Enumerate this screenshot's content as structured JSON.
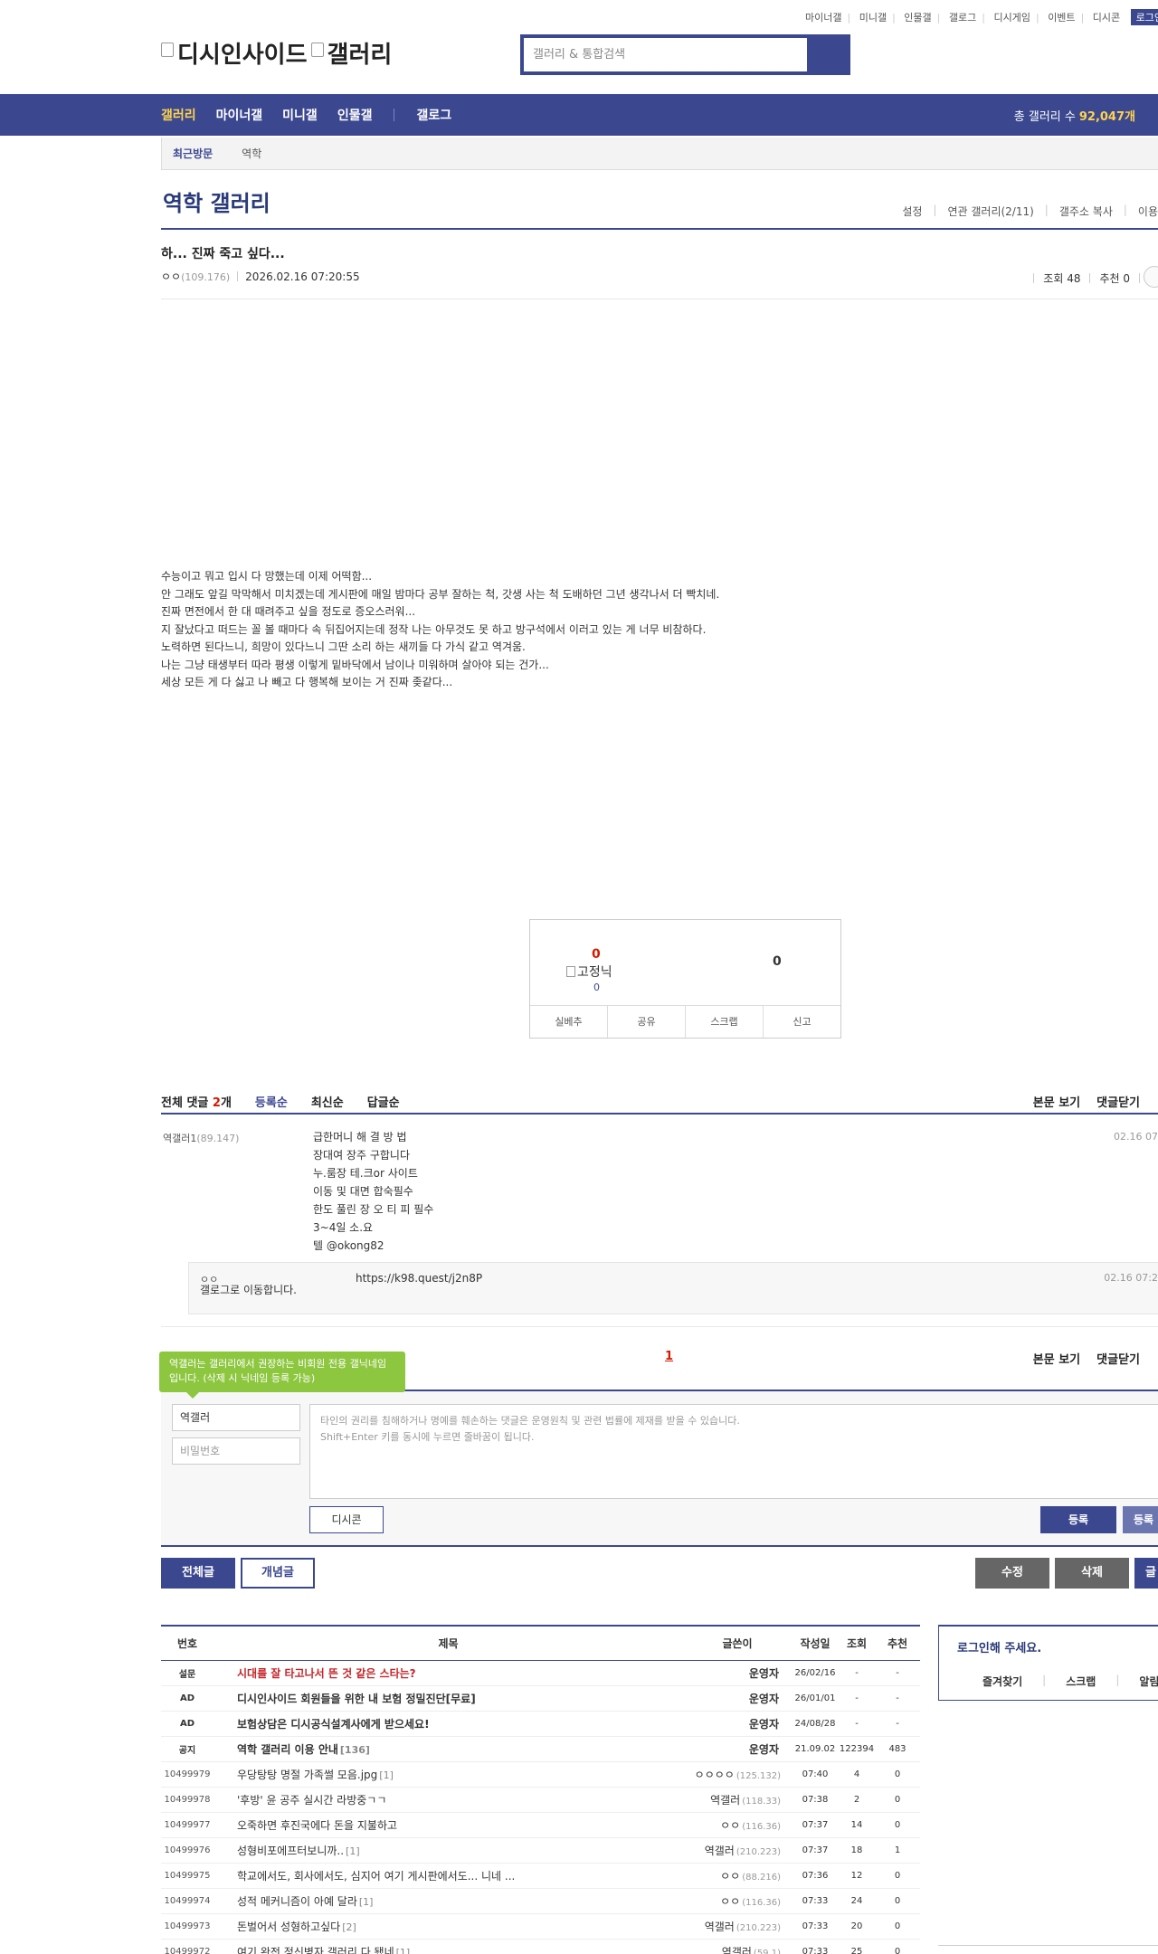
{
  "util": {
    "links": [
      "마이너갤",
      "미니갤",
      "인물갤",
      "갤로그",
      "디시게임",
      "이벤트",
      "디시콘"
    ],
    "login": "로그인"
  },
  "header": {
    "logo_alt_1": "디시인사이드",
    "logo_alt_2": "갤러리",
    "search_placeholder": "갤러리 & 통합검색"
  },
  "nav": {
    "items": [
      "갤러리",
      "마이너갤",
      "미니갤",
      "인물갤",
      "갤로그"
    ],
    "total_label": "총 갤러리 수",
    "total_count": "92,047개"
  },
  "recent": {
    "label": "최근방문",
    "items": [
      "역학"
    ]
  },
  "gallery": {
    "title": "역학 갤러리",
    "tools": [
      "설정",
      "연관 갤러리(2/11)",
      "갤주소 복사",
      "이용"
    ]
  },
  "post": {
    "title": "하... 진짜 죽고 싶다...",
    "author": "ㅇㅇ",
    "author_ip": "(109.176)",
    "date": "2026.02.16 07:20:55",
    "views": "조회 48",
    "recommend": "추천 0",
    "body": [
      "수능이고 뭐고 입시 다 망했는데 이제 어떡함...",
      "안 그래도 앞길 막막해서 미치겠는데 게시판에 매일 밤마다 공부 잘하는 척, 갓생 사는 척 도배하던 그년 생각나서 더 빡치네.",
      "진짜 면전에서 한 대 때려주고 싶을 정도로 증오스러워...",
      "지 잘났다고 떠드는 꼴 볼 때마다 속 뒤집어지는데 정작 나는 아무것도 못 하고 방구석에서 이러고 있는 게 너무 비참하다.",
      "노력하면 된다느니, 희망이 있다느니 그딴 소리 하는 새끼들 다 가식 같고 역겨움.",
      "나는 그냥 태생부터 따라 평생 이렇게 밑바닥에서 남이나 미워하며 살아야 되는 건가...",
      "세상 모든 게 다 싫고 나 빼고 다 행복해 보이는 거 진짜 좆같다..."
    ]
  },
  "recommend_box": {
    "up_count": "0",
    "up_img_alt": "고정닉",
    "up_fixed": "0",
    "down_count": "0",
    "actions": [
      "실베추",
      "공유",
      "스크랩",
      "신고"
    ]
  },
  "comments": {
    "label": "전체 댓글",
    "count": "2",
    "count_suffix": "개",
    "sorts": [
      "등록순",
      "최신순",
      "답글순"
    ],
    "right_actions": [
      "본문 보기",
      "댓글닫기"
    ],
    "list": [
      {
        "name": "역갤러1",
        "ip": "(89.147)",
        "date": "02.16 07",
        "lines": [
          "급한머니 해 결 방 법",
          "장대여 장주 구합니다",
          "누.룸장 테.크or 사이트",
          "이동 및 대면 합숙필수",
          "한도 풀린 장 오 티 피 필수",
          "3~4일 소.요",
          "텔 @okong82"
        ]
      }
    ],
    "reply": {
      "name": "ㅇㅇ",
      "img_alt": "갤로그로 이동합니다.",
      "text": "https://k98.quest/j2n8P",
      "date": "02.16 07:2"
    },
    "page": "1"
  },
  "write": {
    "tooltip": "역갤러는 갤러리에서 권장하는 비회원 전용 갤닉네임입니다. (삭제 시 닉네임 등록 가능)",
    "nickname": "역갤러",
    "password_placeholder": "비밀번호",
    "notice_1": "타인의 권리를 침해하거나 명예를 훼손하는 댓글은 운영원칙 및 관련 법률에 제재를 받을 수 있습니다.",
    "notice_2": "Shift+Enter 키를 동시에 누르면 줄바꿈이 됩니다.",
    "dccon": "디시콘",
    "submit": "등록",
    "submit2": "등록"
  },
  "post_buttons": {
    "all": "전체글",
    "concept": "개념글",
    "edit": "수정",
    "delete": "삭제",
    "write": "글"
  },
  "list": {
    "headers": [
      "번호",
      "제목",
      "글쓴이",
      "작성일",
      "조회",
      "추천"
    ],
    "rows": [
      {
        "num": "설문",
        "title": "시대를 잘 타고나서 뜬 것 같은 스타는?",
        "rc": "",
        "writer": "운영자",
        "ip": "",
        "date": "26/02/16",
        "views": "-",
        "rec": "-",
        "type": "survey"
      },
      {
        "num": "AD",
        "title": "디시인사이드 회원들을 위한 내 보험 정밀진단[무료]",
        "rc": "",
        "writer": "운영자",
        "ip": "",
        "date": "26/01/01",
        "views": "-",
        "rec": "-",
        "type": "notice"
      },
      {
        "num": "AD",
        "title": "보험상담은 디시공식설계사에게 받으세요!",
        "rc": "",
        "writer": "운영자",
        "ip": "",
        "date": "24/08/28",
        "views": "-",
        "rec": "-",
        "type": "notice"
      },
      {
        "num": "공지",
        "title": "역학 갤러리 이용 안내",
        "rc": "[136]",
        "writer": "운영자",
        "ip": "",
        "date": "21.09.02",
        "views": "122394",
        "rec": "483",
        "type": "notice"
      },
      {
        "num": "10499979",
        "title": "우당탕탕 명절 가족썰 모음.jpg",
        "rc": "[1]",
        "writer": "ㅇㅇㅇㅇ",
        "ip": "(125.132)",
        "date": "07:40",
        "views": "4",
        "rec": "0",
        "type": ""
      },
      {
        "num": "10499978",
        "title": "'후방' 윤 공주 실시간 라방중ㄱㄱ",
        "rc": "",
        "writer": "역갤러",
        "ip": "(118.33)",
        "date": "07:38",
        "views": "2",
        "rec": "0",
        "type": ""
      },
      {
        "num": "10499977",
        "title": "오죽하면 후진국에다 돈을 지불하고",
        "rc": "",
        "writer": "ㅇㅇ",
        "ip": "(116.36)",
        "date": "07:37",
        "views": "14",
        "rec": "0",
        "type": ""
      },
      {
        "num": "10499976",
        "title": "성형비포에프터보니까..",
        "rc": "[1]",
        "writer": "역갤러",
        "ip": "(210.223)",
        "date": "07:37",
        "views": "18",
        "rec": "1",
        "type": ""
      },
      {
        "num": "10499975",
        "title": "학교에서도, 회사에서도, 심지어 여기 게시판에서도... 니네 ...",
        "rc": "",
        "writer": "ㅇㅇ",
        "ip": "(88.216)",
        "date": "07:36",
        "views": "12",
        "rec": "0",
        "type": ""
      },
      {
        "num": "10499974",
        "title": "성적 메커니즘이 아예 달라",
        "rc": "[1]",
        "writer": "ㅇㅇ",
        "ip": "(116.36)",
        "date": "07:33",
        "views": "24",
        "rec": "0",
        "type": ""
      },
      {
        "num": "10499973",
        "title": "돈벌어서 성형하고싶다",
        "rc": "[2]",
        "writer": "역갤러",
        "ip": "(210.223)",
        "date": "07:33",
        "views": "20",
        "rec": "0",
        "type": ""
      },
      {
        "num": "10499972",
        "title": "여기 완전 정신병자 갤러리 다 됐네",
        "rc": "[1]",
        "writer": "역갤러",
        "ip": "(59.1)",
        "date": "07:33",
        "views": "25",
        "rec": "0",
        "type": ""
      }
    ]
  },
  "login_panel": {
    "message": "로그인해 주세요.",
    "actions": [
      "즐겨찾기",
      "스크랩",
      "알림"
    ]
  },
  "colors": {
    "brand": "#3b4890",
    "accent_yellow": "#ffd24d",
    "alert_red": "#d31900",
    "tooltip_green": "#8dc63f"
  }
}
